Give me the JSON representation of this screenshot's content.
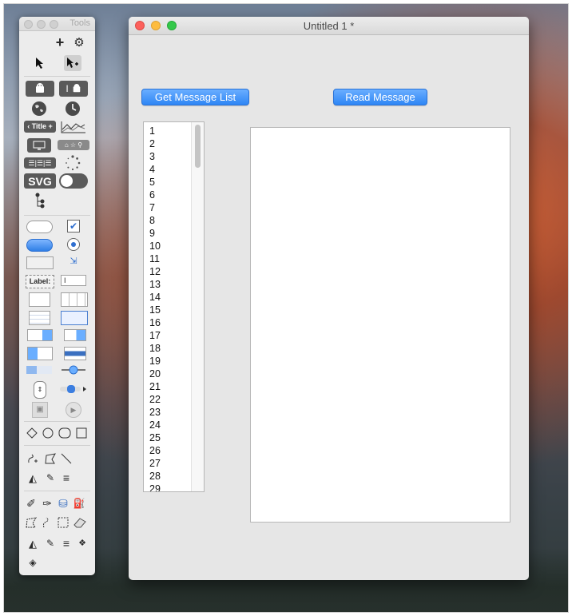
{
  "tools_palette": {
    "title": "Tools",
    "tool_icons": [
      "add-icon",
      "gear-icon",
      "arrow-pointer-icon",
      "arrow-add-icon",
      "android-icon",
      "android-text-icon",
      "globe-icon",
      "clock-icon",
      "title-bar-icon",
      "chart-icon",
      "screen-icon",
      "search-bar-icon",
      "segmented-icon",
      "spinner-icon",
      "svg-icon",
      "toggle-icon",
      "tree-icon",
      "push-button-icon",
      "checkbox-icon",
      "blue-button-icon",
      "radio-icon",
      "bevel-button-icon",
      "disclosure-icon",
      "label-icon",
      "text-field-icon",
      "stepper-field-icon",
      "table-icon",
      "list-icon",
      "scroll-list-icon",
      "popup-icon",
      "combo-icon",
      "combo-text-icon",
      "date-icon",
      "progress-icon",
      "slider-icon",
      "stepper-icon",
      "track-icon",
      "image-well-icon",
      "movie-icon",
      "diamond-icon",
      "circle-icon",
      "rounded-rect-icon",
      "rect-icon",
      "freeform-icon",
      "polygon-icon",
      "line-icon",
      "paint-icon",
      "pencil-icon",
      "lines-icon",
      "pen-icon",
      "brush-icon",
      "bucket-icon",
      "spray-icon",
      "poly-select-icon",
      "lasso-icon",
      "marquee-icon",
      "eraser-icon",
      "fill-icon",
      "dropper-icon",
      "weight-icon",
      "pattern-icon",
      "shape-icon"
    ],
    "label_tool": "Label:",
    "svg_tool": "SVG",
    "title_tool": "Title"
  },
  "window": {
    "title": "Untitled 1 *",
    "get_message_list_button": "Get Message List",
    "read_message_button": "Read Message",
    "list_items": [
      "1",
      "2",
      "3",
      "4",
      "5",
      "6",
      "7",
      "8",
      "9",
      "10",
      "11",
      "12",
      "13",
      "14",
      "15",
      "16",
      "17",
      "18",
      "19",
      "20",
      "21",
      "22",
      "23",
      "24",
      "25",
      "26",
      "27",
      "28",
      "29"
    ],
    "message_text": ""
  },
  "colors": {
    "button_blue": "#2e86f5",
    "close_red": "#fc605c",
    "minimize_yellow": "#fdbc40",
    "zoom_green": "#34c84a"
  }
}
